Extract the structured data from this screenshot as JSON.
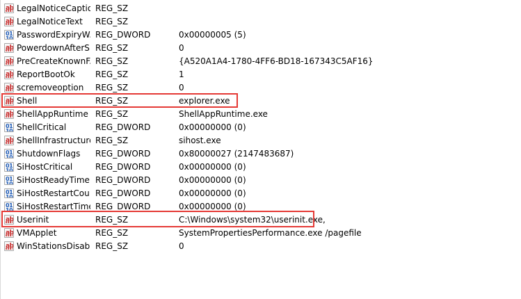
{
  "registry_values": [
    {
      "name": "LegalNoticeCaption",
      "display_name": "LegalNoticeCaption",
      "type": "REG_SZ",
      "data": "",
      "icon": "string-value-icon"
    },
    {
      "name": "LegalNoticeText",
      "display_name": "LegalNoticeText",
      "type": "REG_SZ",
      "data": "",
      "icon": "string-value-icon"
    },
    {
      "name": "PasswordExpiryWarning",
      "display_name": "PasswordExpiryW...",
      "type": "REG_DWORD",
      "data": "0x00000005 (5)",
      "icon": "dword-value-icon"
    },
    {
      "name": "PowerdownAfterShutdown",
      "display_name": "PowerdownAfterS...",
      "type": "REG_SZ",
      "data": "0",
      "icon": "string-value-icon"
    },
    {
      "name": "PreCreateKnownFolders",
      "display_name": "PreCreateKnownF...",
      "type": "REG_SZ",
      "data": "{A520A1A4-1780-4FF6-BD18-167343C5AF16}",
      "icon": "string-value-icon"
    },
    {
      "name": "ReportBootOk",
      "display_name": "ReportBootOk",
      "type": "REG_SZ",
      "data": "1",
      "icon": "string-value-icon"
    },
    {
      "name": "scremoveoption",
      "display_name": "scremoveoption",
      "type": "REG_SZ",
      "data": "0",
      "icon": "string-value-icon"
    },
    {
      "name": "Shell",
      "display_name": "Shell",
      "type": "REG_SZ",
      "data": "explorer.exe",
      "icon": "string-value-icon"
    },
    {
      "name": "ShellAppRuntime",
      "display_name": "ShellAppRuntime",
      "type": "REG_SZ",
      "data": "ShellAppRuntime.exe",
      "icon": "string-value-icon"
    },
    {
      "name": "ShellCritical",
      "display_name": "ShellCritical",
      "type": "REG_DWORD",
      "data": "0x00000000 (0)",
      "icon": "dword-value-icon"
    },
    {
      "name": "ShellInfrastructure",
      "display_name": "ShellInfrastructure",
      "type": "REG_SZ",
      "data": "sihost.exe",
      "icon": "string-value-icon"
    },
    {
      "name": "ShutdownFlags",
      "display_name": "ShutdownFlags",
      "type": "REG_DWORD",
      "data": "0x80000027 (2147483687)",
      "icon": "dword-value-icon"
    },
    {
      "name": "SiHostCritical",
      "display_name": "SiHostCritical",
      "type": "REG_DWORD",
      "data": "0x00000000 (0)",
      "icon": "dword-value-icon"
    },
    {
      "name": "SiHostReadyTimeOut",
      "display_name": "SiHostReadyTime...",
      "type": "REG_DWORD",
      "data": "0x00000000 (0)",
      "icon": "dword-value-icon"
    },
    {
      "name": "SiHostRestartCountLimit",
      "display_name": "SiHostRestartCou...",
      "type": "REG_DWORD",
      "data": "0x00000000 (0)",
      "icon": "dword-value-icon"
    },
    {
      "name": "SiHostRestartTimeGap",
      "display_name": "SiHostRestartTime...",
      "type": "REG_DWORD",
      "data": "0x00000000 (0)",
      "icon": "dword-value-icon"
    },
    {
      "name": "Userinit",
      "display_name": "Userinit",
      "type": "REG_SZ",
      "data": "C:\\Windows\\system32\\userinit.exe,",
      "icon": "string-value-icon"
    },
    {
      "name": "VMApplet",
      "display_name": "VMApplet",
      "type": "REG_SZ",
      "data": "SystemPropertiesPerformance.exe /pagefile",
      "icon": "string-value-icon"
    },
    {
      "name": "WinStationsDisabled",
      "display_name": "WinStationsDisabl...",
      "type": "REG_SZ",
      "data": "0",
      "icon": "string-value-icon"
    }
  ],
  "highlight_color": "#e53935",
  "string_icon_color": "#c62828",
  "dword_icon_color": "#1e5bb8"
}
